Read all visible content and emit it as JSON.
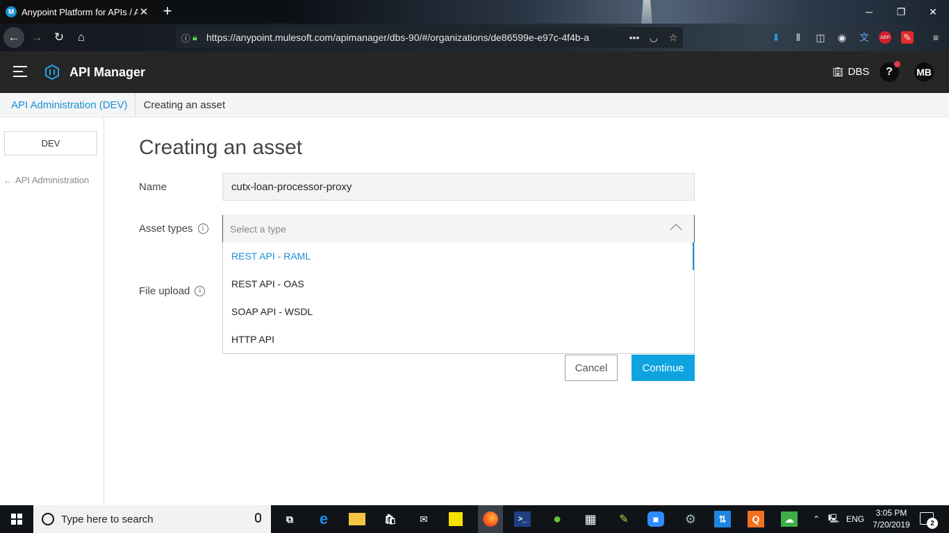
{
  "browser": {
    "tab_title": "Anypoint Platform for APIs / A",
    "tab_favicon_letter": "M",
    "url": "https://anypoint.mulesoft.com/apimanager/dbs-90/#/organizations/de86599e-e97c-4f4b-a",
    "page_actions_icon": "ellipsis-icon"
  },
  "header": {
    "app_name": "API Manager",
    "org_name": "DBS",
    "help_label": "?",
    "user_initials": "MB"
  },
  "breadcrumb": {
    "parent": "API Administration (DEV)",
    "current": "Creating an asset"
  },
  "sidebar": {
    "environment": "DEV",
    "back_link": "API Administration"
  },
  "main": {
    "title": "Creating an asset",
    "name_label": "Name",
    "name_value": "cutx-loan-processor-proxy",
    "asset_types_label": "Asset types",
    "asset_types_placeholder": "Select a type",
    "asset_type_options": [
      "REST API - RAML",
      "REST API - OAS",
      "SOAP API - WSDL",
      "HTTP API"
    ],
    "highlighted_option_index": 0,
    "file_upload_label": "File upload",
    "cancel_label": "Cancel",
    "continue_label": "Continue"
  },
  "colors": {
    "accent": "#0fa4e0",
    "link": "#1a8fd6",
    "app_header": "#262626"
  },
  "taskbar": {
    "search_placeholder": "Type here to search",
    "language": "ENG",
    "time": "3:05 PM",
    "date": "7/20/2019",
    "notification_count": "2"
  }
}
